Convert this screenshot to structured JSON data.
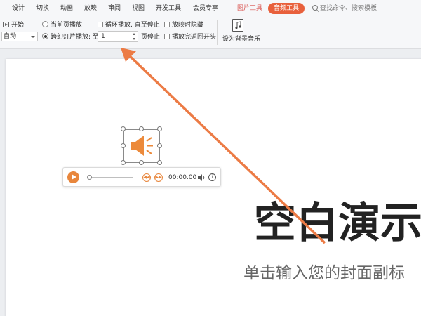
{
  "tabs": [
    "设计",
    "切换",
    "动画",
    "放映",
    "审阅",
    "视图",
    "开发工具",
    "会员专享"
  ],
  "tool_tabs": {
    "picture": "图片工具",
    "audio": "音频工具"
  },
  "search": {
    "placeholder": "查找命令、搜索模板"
  },
  "ribbon": {
    "start_label": "开始",
    "start_select_value": "自动",
    "radio_current": "当前页播放",
    "radio_cross": "跨幻灯片播放: 至",
    "stop_page_value": "1",
    "stop_page_suffix": "页停止",
    "loop_label": "循环播放, 直至停止",
    "hide_label": "放映时隐藏",
    "rewind_label": "播放完返回开头",
    "bg_music_label": "设为背景音乐"
  },
  "player": {
    "time": "00:00.00",
    "prev_label": "◀◀",
    "next_label": "▶▶",
    "info_label": "i"
  },
  "slide": {
    "title": "空白演示",
    "subtitle": "单击输入您的封面副标"
  },
  "colors": {
    "accent": "#e8603c",
    "arrow": "#ec7b45",
    "speaker": "#ec8a3b"
  }
}
